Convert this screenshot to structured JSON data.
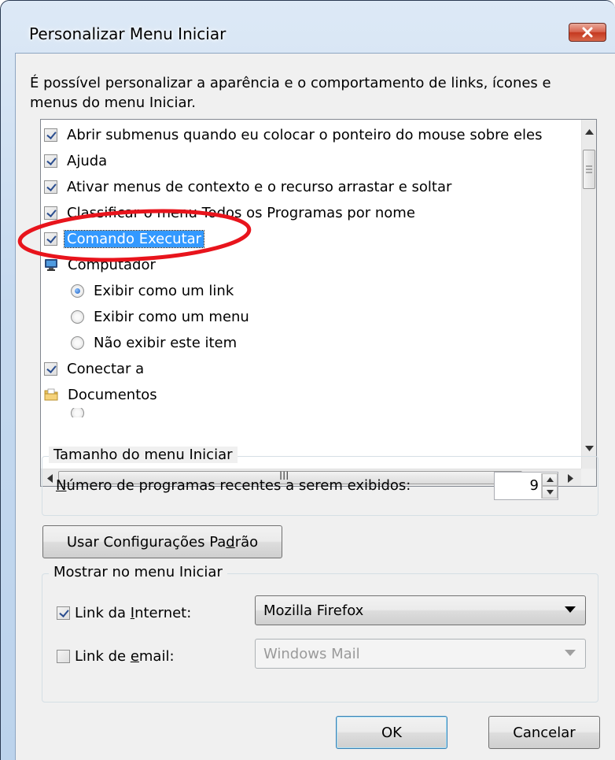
{
  "dialog": {
    "title": "Personalizar Menu Iniciar",
    "description": "É possível personalizar a aparência e o comportamento de links, ícones e menus do menu Iniciar."
  },
  "list": {
    "items": [
      {
        "type": "checkbox",
        "checked": true,
        "label": "Abrir submenus quando eu colocar o ponteiro do mouse sobre eles"
      },
      {
        "type": "checkbox",
        "checked": true,
        "label": "Ajuda"
      },
      {
        "type": "checkbox",
        "checked": true,
        "label": "Ativar menus de contexto e o recurso arrastar e soltar"
      },
      {
        "type": "checkbox",
        "checked": true,
        "label": "Classificar o menu Todos os Programas por nome"
      },
      {
        "type": "checkbox",
        "checked": true,
        "label": "Comando Executar",
        "selected": true
      },
      {
        "type": "icon",
        "icon": "computer-icon",
        "label": "Computador"
      },
      {
        "type": "radio",
        "checked": true,
        "label": "Exibir como um link"
      },
      {
        "type": "radio",
        "checked": false,
        "label": "Exibir como um menu"
      },
      {
        "type": "radio",
        "checked": false,
        "label": "Não exibir este item"
      },
      {
        "type": "checkbox",
        "checked": true,
        "label": "Conectar a"
      },
      {
        "type": "icon",
        "icon": "documents-folder-icon",
        "label": "Documentos"
      }
    ],
    "hscroll_grip": "III"
  },
  "menu_size": {
    "legend": "Tamanho do menu Iniciar",
    "recent_label_prefix": "N",
    "recent_label_rest": "úmero de programas recentes a serem exibidos:",
    "recent_value": "9"
  },
  "defaults_button": {
    "label_prefix": "Usar Configurações Pa",
    "label_underline": "d",
    "label_rest": "rão"
  },
  "show_in_menu": {
    "legend": "Mostrar no menu Iniciar",
    "internet": {
      "label_prefix": "Link da ",
      "label_underline": "I",
      "label_rest": "nternet:",
      "checked": true,
      "value": "Mozilla Firefox"
    },
    "email": {
      "label_prefix": "Link de ",
      "label_underline": "e",
      "label_rest": "mail:",
      "checked": false,
      "value": "Windows Mail"
    }
  },
  "buttons": {
    "ok": "OK",
    "cancel": "Cancelar"
  },
  "colors": {
    "selection": "#3399ff",
    "highlight_ellipse": "#e8141c",
    "close_button": "#c4381f"
  }
}
